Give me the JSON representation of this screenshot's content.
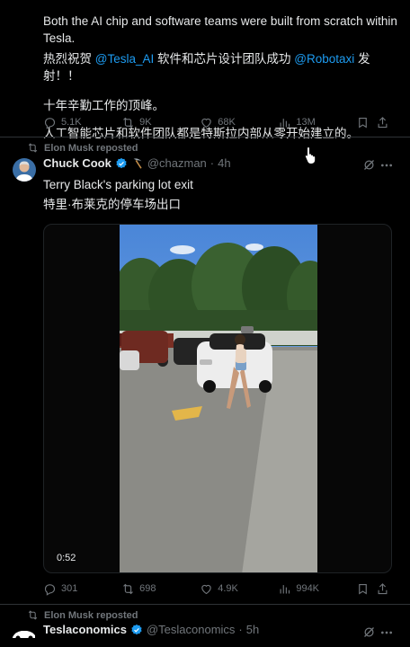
{
  "tweet1": {
    "line1": "Both the AI chip and software teams were built from scratch within Tesla.",
    "line2_pre": "热烈祝贺 ",
    "mention1": "@Tesla_AI",
    "line2_mid": " 软件和芯片设计团队成功 ",
    "mention2": "@Robotaxi",
    "line2_post": " 发射！！",
    "para2": "十年辛勤工作的顶峰。",
    "para3": "人工智能芯片和软件团队都是特斯拉内部从零开始建立的。",
    "replies": "5.1K",
    "reposts": "9K",
    "likes": "68K",
    "views": "13M"
  },
  "tweet2": {
    "reposted_by": "Elon Musk reposted",
    "name": "Chuck Cook",
    "handle": "@chazman",
    "separator": "·",
    "time": "4h",
    "text_en": "Terry Black's parking lot exit",
    "text_zh": "特里·布莱克的停车场出口",
    "video_duration": "0:52",
    "replies": "301",
    "reposts": "698",
    "likes": "4.9K",
    "views": "994K"
  },
  "tweet3": {
    "reposted_by": "Elon Musk reposted",
    "name": "Teslaconomics",
    "handle": "@Teslaconomics",
    "separator": "·",
    "time": "5h"
  },
  "colors": {
    "background": "#000000",
    "text": "#e7e9ea",
    "muted": "#71767b",
    "link": "#1d9bf0",
    "divider": "#2f3336"
  }
}
